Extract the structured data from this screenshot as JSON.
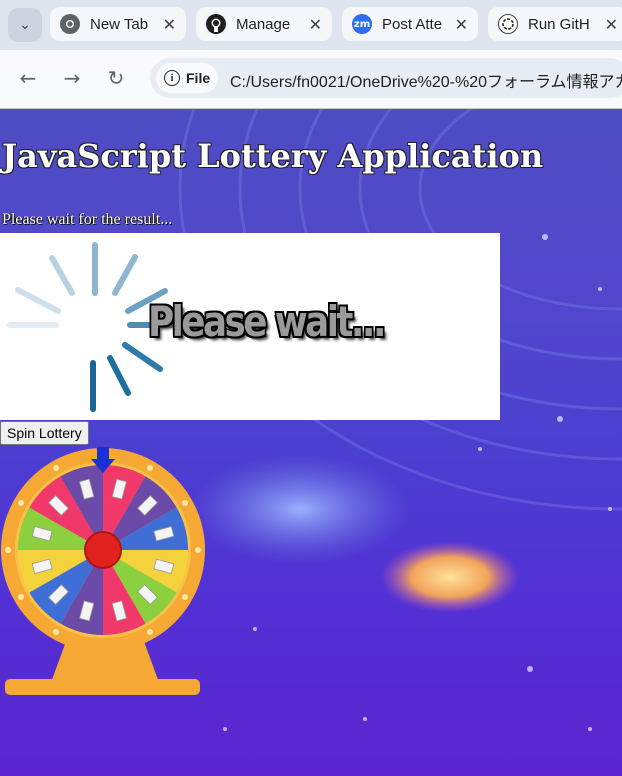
{
  "tabs": [
    {
      "title": "New Tab",
      "icon": "chrome-icon"
    },
    {
      "title": "Manage",
      "icon": "github-icon"
    },
    {
      "title": "Post Atte",
      "icon": "zoom-icon",
      "icon_text": "zm"
    },
    {
      "title": "Run GitH",
      "icon": "openai-icon"
    }
  ],
  "address_bar": {
    "scheme_chip": "File",
    "url": "C:/Users/fn0021/OneDrive%20-%20フォーラム情報アカ"
  },
  "page": {
    "heading": "JavaScript Lottery Application",
    "status": "Please wait for the result...",
    "loading_text": "Please wait...",
    "spin_button": "Spin Lottery"
  },
  "colors": {
    "page_bg": "#4d4cc2",
    "wheel_frame": "#f5a934",
    "wheel_center": "#e0221f",
    "pointer": "#1a2fd6",
    "spinner": "#1f77a8"
  }
}
